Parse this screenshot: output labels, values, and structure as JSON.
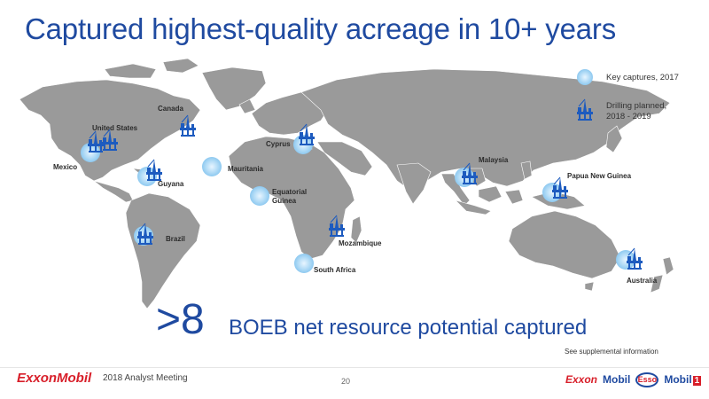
{
  "slide": {
    "title": "Captured highest-quality acreage in 10+ years",
    "legend": {
      "key_captures": "Key captures, 2017",
      "drilling_planned_line1": "Drilling planned,",
      "drilling_planned_line2": "2018 - 2019"
    },
    "locations": {
      "canada": "Canada",
      "united_states": "United States",
      "mexico": "Mexico",
      "guyana": "Guyana",
      "brazil": "Brazil",
      "mauritania": "Mauritania",
      "cyprus": "Cyprus",
      "equatorial_guinea_line1": "Equatorial",
      "equatorial_guinea_line2": "Guinea",
      "mozambique": "Mozambique",
      "south_africa": "South Africa",
      "malaysia": "Malaysia",
      "papua_new_guinea": "Papua New Guinea",
      "australia": "Australia"
    },
    "headline": {
      "value": ">8",
      "text": "BOEB net resource potential captured"
    },
    "supplemental": "See supplemental information"
  },
  "footer": {
    "logo": "ExxonMobil",
    "meeting": "2018 Analyst Meeting",
    "page_number": "20",
    "brands": {
      "exxon": "Exxon",
      "mobil": "Mobil",
      "esso": "Esso",
      "mobil1_text": "Mobil",
      "mobil1_num": "1"
    }
  },
  "colors": {
    "title_blue": "#1f4aa0",
    "map_gray": "#9a9a9a",
    "capture_circle": "#b3dcf7",
    "rig_blue": "#1d5bbf",
    "exxon_red": "#d81f2a"
  },
  "icons": {
    "key_capture": "capture-circle-icon",
    "drilling": "drilling-rig-icon"
  }
}
